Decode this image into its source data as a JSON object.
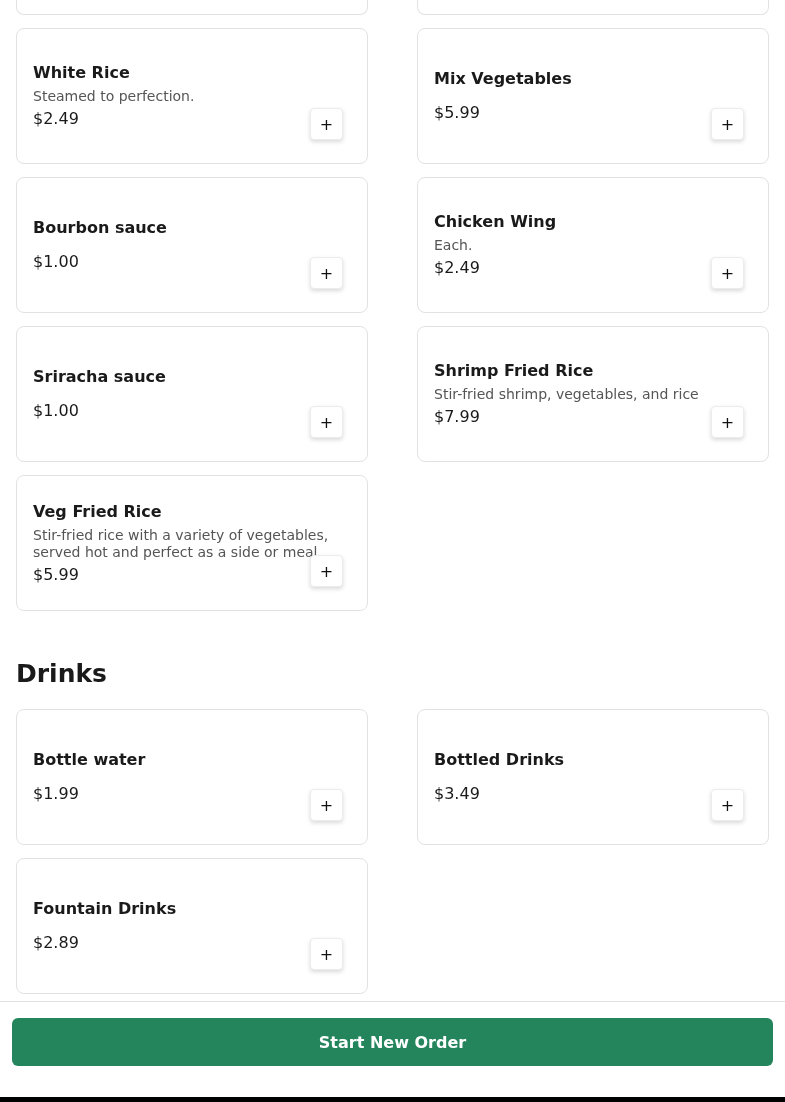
{
  "sections": [
    {
      "items": [
        {
          "name": "White Rice",
          "description": "Steamed to perfection.",
          "price": "$2.49",
          "add_label": "+"
        },
        {
          "name": "Mix Vegetables",
          "price": "$5.99",
          "add_label": "+"
        },
        {
          "name": "Bourbon sauce",
          "price": "$1.00",
          "add_label": "+"
        },
        {
          "name": "Chicken Wing",
          "description": "Each.",
          "price": "$2.49",
          "add_label": "+"
        },
        {
          "name": "Sriracha sauce",
          "price": "$1.00",
          "add_label": "+"
        },
        {
          "name": "Shrimp Fried Rice",
          "description": "Stir-fried shrimp, vegetables, and rice",
          "price": "$7.99",
          "add_label": "+"
        },
        {
          "name": "Veg Fried Rice",
          "description": "Stir-fried rice with a variety of vegetables, served hot and perfect as a side or meal",
          "price": "$5.99",
          "add_label": "+"
        }
      ]
    },
    {
      "heading": "Drinks",
      "items": [
        {
          "name": "Bottle water",
          "price": "$1.99",
          "add_label": "+"
        },
        {
          "name": "Bottled Drinks",
          "price": "$3.49",
          "add_label": "+"
        },
        {
          "name": "Fountain Drinks",
          "price": "$2.89",
          "add_label": "+"
        }
      ]
    }
  ],
  "footer": {
    "button": "Start New Order"
  }
}
